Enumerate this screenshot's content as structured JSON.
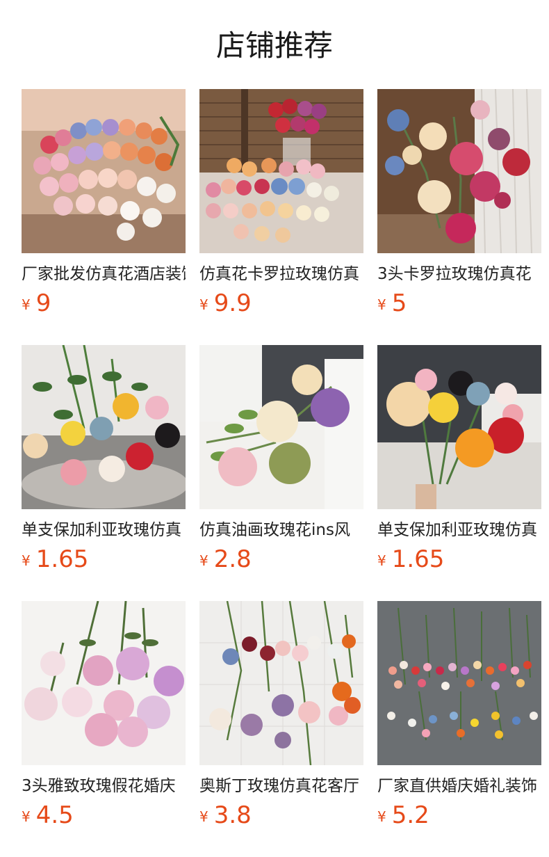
{
  "header": {
    "title": "店铺推荐"
  },
  "products": [
    {
      "name": "厂家批发仿真花酒店装饰",
      "currency": "¥",
      "price": "9",
      "image_alt": "mixed-rose-bunch-photo"
    },
    {
      "name": "仿真花卡罗拉玫瑰仿真",
      "currency": "¥",
      "price": "9.9",
      "image_alt": "rose-bouquet-on-wood-photo"
    },
    {
      "name": "3头卡罗拉玫瑰仿真花",
      "currency": "¥",
      "price": "5",
      "image_alt": "three-head-rose-photo"
    },
    {
      "name": "单支保加利亚玫瑰仿真",
      "currency": "¥",
      "price": "1.65",
      "image_alt": "single-bulgarian-rose-photo"
    },
    {
      "name": "仿真油画玫瑰花ins风",
      "currency": "¥",
      "price": "2.8",
      "image_alt": "oil-painting-rose-photo"
    },
    {
      "name": "单支保加利亚玫瑰仿真",
      "currency": "¥",
      "price": "1.65",
      "image_alt": "single-rose-hand-held-photo"
    },
    {
      "name": "3头雅致玫瑰假花婚庆",
      "currency": "¥",
      "price": "4.5",
      "image_alt": "elegant-rose-photo"
    },
    {
      "name": "奥斯丁玫瑰仿真花客厅",
      "currency": "¥",
      "price": "3.8",
      "image_alt": "austin-rose-photo"
    },
    {
      "name": "厂家直供婚庆婚礼装饰",
      "currency": "¥",
      "price": "5.2",
      "image_alt": "wedding-rose-sprays-photo"
    }
  ],
  "colors": {
    "price": "#e64a19",
    "title": "#1a1a1a",
    "text": "#222222"
  }
}
